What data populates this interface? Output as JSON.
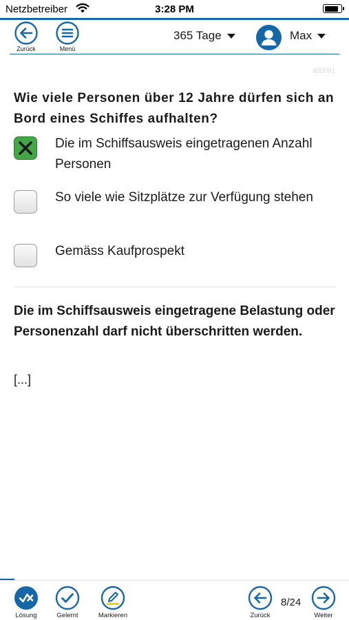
{
  "status_bar": {
    "carrier": "Netzbetreiber",
    "time": "3:28 PM",
    "battery_level": 0.9
  },
  "header": {
    "back_label": "Zurück",
    "menu_label": "Menü",
    "days_value": "365 Tage",
    "user_name": "Max"
  },
  "question_id": "400091",
  "question": "Wie viele Personen über 12 Jahre dürfen sich an Bord eines Schiffes aufhalten?",
  "answers": [
    {
      "text": "Die im Schiffsausweis eingetragenen Anzahl Personen",
      "checked": true
    },
    {
      "text": "So viele wie Sitzplätze zur Verfügung stehen",
      "checked": false
    },
    {
      "text": "Gemäss Kaufprospekt",
      "checked": false
    }
  ],
  "explanation": "Die im Schiffsausweis eingetragene Belastung oder Personenzahl darf nicht überschritten werden.",
  "ellipsis": "[...]",
  "toolbar": {
    "solution_label": "Lösung",
    "learned_label": "Gelernt",
    "mark_label": "Markieren",
    "prev_label": "Zurück",
    "next_label": "Weiter",
    "page_indicator": "8/24",
    "current_page": 8,
    "total_pages": 24
  },
  "colors": {
    "accent": "#1667a8",
    "correct": "#43a748"
  }
}
